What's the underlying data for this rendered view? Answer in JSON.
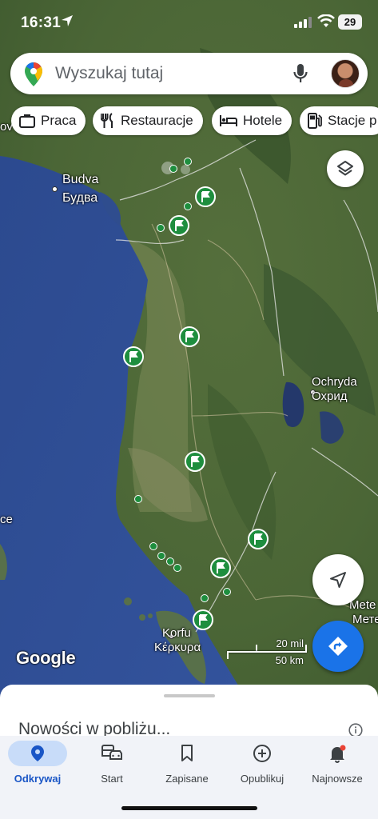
{
  "status_bar": {
    "time": "16:31",
    "battery": "29"
  },
  "search": {
    "placeholder": "Wyszukaj tutaj"
  },
  "chips": [
    {
      "label": "Praca",
      "icon": "briefcase-icon"
    },
    {
      "label": "Restauracje",
      "icon": "restaurant-icon"
    },
    {
      "label": "Hotele",
      "icon": "hotel-icon"
    },
    {
      "label": "Stacje p",
      "icon": "gas-station-icon"
    }
  ],
  "map": {
    "labels": {
      "budva_latin": "Budva",
      "budva_cyrillic": "Будва",
      "ohrid_latin": "Ochryda",
      "ohrid_cyrillic": "Охрид",
      "corfu_latin": "Korfu",
      "corfu_greek": "Κέρκυρα",
      "left_edge": "ce",
      "right_edge_1": "Mete",
      "right_edge_2": "Мете",
      "top_left": "ov"
    },
    "scale": {
      "miles": "20 mil",
      "km": "50 km"
    },
    "attribution": "Google",
    "colors": {
      "sea": "#2f4f93",
      "land": "#4f6a3a",
      "marker": "#1e8e3e"
    }
  },
  "sheet": {
    "title": "Nowości w pobliżu..."
  },
  "nav": [
    {
      "label": "Odkrywaj",
      "icon": "location-pin-icon",
      "active": true
    },
    {
      "label": "Start",
      "icon": "commute-icon",
      "active": false
    },
    {
      "label": "Zapisane",
      "icon": "bookmark-icon",
      "active": false
    },
    {
      "label": "Opublikuj",
      "icon": "add-circle-icon",
      "active": false
    },
    {
      "label": "Najnowsze",
      "icon": "bell-icon",
      "active": false
    }
  ]
}
